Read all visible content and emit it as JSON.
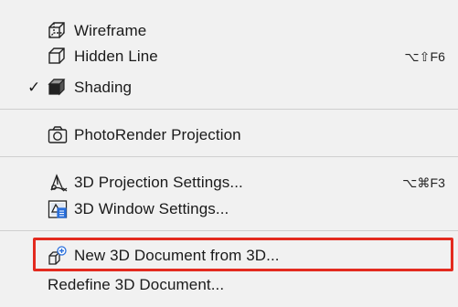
{
  "menu": {
    "items": [
      {
        "label": "Wireframe",
        "icon": "wireframe-icon",
        "checked": false,
        "shortcut": ""
      },
      {
        "label": "Hidden Line",
        "icon": "hidden-line-icon",
        "checked": false,
        "shortcut": "⌥⇧F6"
      },
      {
        "label": "Shading",
        "icon": "shading-icon",
        "checked": true,
        "check": "✓",
        "shortcut": ""
      },
      {
        "label": "PhotoRender Projection",
        "icon": "camera-icon",
        "checked": false,
        "shortcut": ""
      },
      {
        "label": "3D Projection Settings...",
        "icon": "projection-settings-icon",
        "checked": false,
        "shortcut": "⌥⌘F3"
      },
      {
        "label": "3D Window Settings...",
        "icon": "window-settings-icon",
        "checked": false,
        "shortcut": ""
      },
      {
        "label": "New 3D Document from 3D...",
        "icon": "new-3d-document-icon",
        "checked": false,
        "shortcut": ""
      },
      {
        "label": "Redefine 3D Document...",
        "icon": "",
        "checked": false,
        "shortcut": ""
      }
    ]
  },
  "highlight_color": "#e32a1f"
}
